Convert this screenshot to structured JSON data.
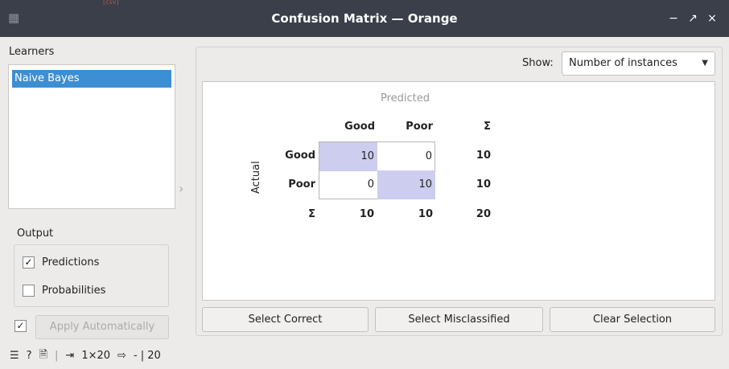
{
  "window": {
    "title": "Confusion Matrix — Orange",
    "top_strip_text": "[csv]",
    "controls": {
      "minimize": "−",
      "restore": "↗",
      "close": "×"
    }
  },
  "learners": {
    "heading": "Learners",
    "items": [
      "Naive Bayes"
    ],
    "selected_index": 0
  },
  "output": {
    "heading": "Output",
    "predictions": {
      "label": "Predictions",
      "checked": true
    },
    "probabilities": {
      "label": "Probabilities",
      "checked": false
    }
  },
  "apply": {
    "label": "Apply Automatically",
    "checked": true,
    "enabled": false
  },
  "show": {
    "label": "Show:",
    "value": "Number of instances"
  },
  "matrix": {
    "predicted_label": "Predicted",
    "actual_label": "Actual",
    "columns": [
      "Good",
      "Poor"
    ],
    "rows": [
      "Good",
      "Poor"
    ],
    "sum_symbol": "Σ",
    "values": [
      [
        "10",
        "0"
      ],
      [
        "0",
        "10"
      ]
    ],
    "row_sums": [
      "10",
      "10"
    ],
    "col_sums": [
      "10",
      "10"
    ],
    "total": "20",
    "highlight_color": "#cdcdf0"
  },
  "buttons": {
    "select_correct": "Select Correct",
    "select_misclassified": "Select Misclassified",
    "clear_selection": "Clear Selection"
  },
  "status": {
    "input_summary": "1×20",
    "output_summary": "- | 20"
  },
  "colors": {
    "titlebar": "#3a3f4a",
    "selection": "#3d8fd4"
  }
}
